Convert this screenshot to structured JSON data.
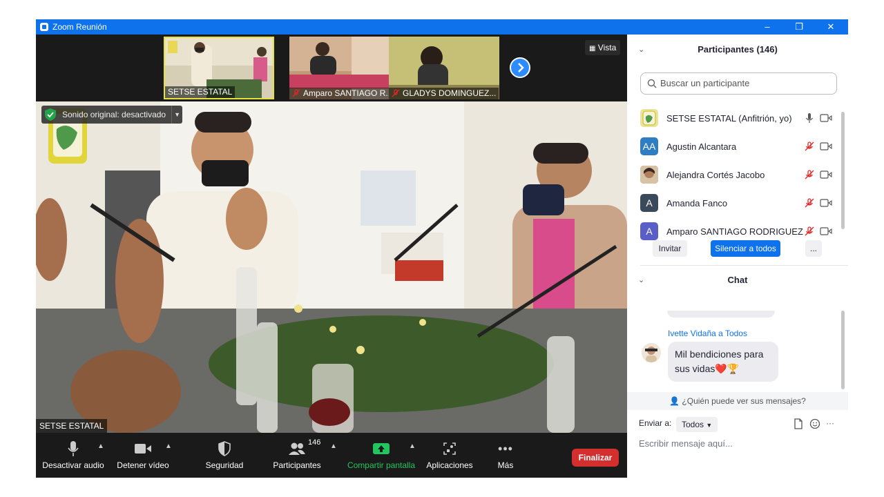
{
  "window": {
    "title": "Zoom Reunión",
    "minimize": "–",
    "restore": "❐",
    "close": "✕"
  },
  "gallery": {
    "thumbnails": [
      {
        "name": "SETSE ESTATAL"
      },
      {
        "name": "Amparo SANTIAGO R..."
      },
      {
        "name": "GLADYS DOMINGUEZ..."
      }
    ],
    "view_label": "Vista"
  },
  "main_video": {
    "speaker_name": "SETSE ESTATAL",
    "original_sound": "Sonido original: desactivado"
  },
  "toolbar": {
    "mute_audio": "Desactivar audio",
    "stop_video": "Detener vídeo",
    "security": "Seguridad",
    "participants": "Participantes",
    "participants_count": "146",
    "share_screen": "Compartir pantalla",
    "apps": "Aplicaciones",
    "more": "Más",
    "end": "Finalizar"
  },
  "participants_panel": {
    "title": "Participantes (146)",
    "search_placeholder": "Buscar un participante",
    "participants": [
      {
        "name": "SETSE ESTATAL (Anfitrión, yo)",
        "avatar": "",
        "avatar_color": "#e8e4a0",
        "muted": false
      },
      {
        "name": "Agustin Alcantara",
        "avatar": "AA",
        "avatar_color": "#2f7dc3",
        "muted": true
      },
      {
        "name": "Alejandra Cortés Jacobo",
        "avatar": "",
        "avatar_color": "#8a6a55",
        "muted": true
      },
      {
        "name": "Amanda Fanco",
        "avatar": "A",
        "avatar_color": "#3b4a5a",
        "muted": true
      },
      {
        "name": "Amparo SANTIAGO RODRIGUEZ",
        "avatar": "A",
        "avatar_color": "#5a5fc8",
        "muted": true
      }
    ],
    "invite": "Invitar",
    "mute_all": "Silenciar a todos",
    "more": "..."
  },
  "chat": {
    "title": "Chat",
    "sender": "Ivette Vidaña a Todos",
    "message": "Mil bendiciones para sus vidas❤️🏆",
    "who_can_see": "¿Quién puede ver sus mensajes?",
    "send_to_label": "Enviar a:",
    "send_to_value": "Todos",
    "input_placeholder": "Escribir mensaje aquí...",
    "more": "···"
  },
  "colors": {
    "zoom_blue": "#0e72ed",
    "end_red": "#d32f2f",
    "share_green": "#22c55e",
    "muted_red": "#e02828"
  }
}
